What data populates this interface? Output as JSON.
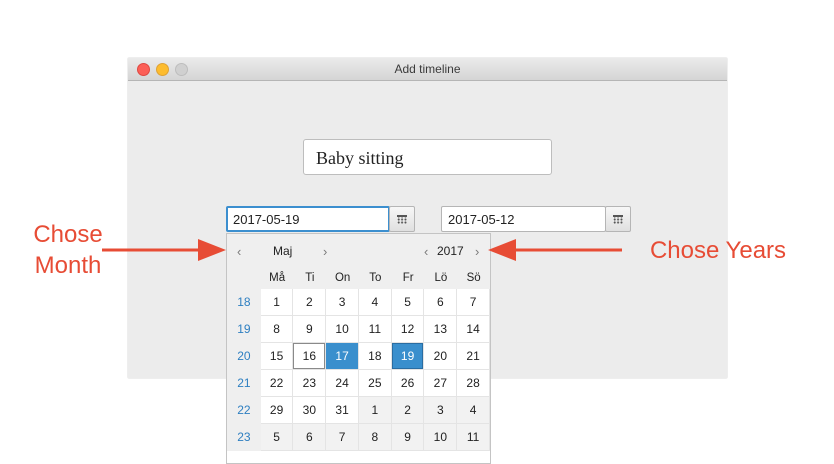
{
  "window": {
    "title": "Add timeline"
  },
  "form": {
    "name_value": "Baby sitting",
    "start_date": "2017-05-19",
    "end_date": "2017-05-12"
  },
  "datepicker": {
    "month": "Maj",
    "year": "2017",
    "prev_arrow": "‹",
    "next_arrow": "›",
    "weekdays": [
      "Må",
      "Ti",
      "On",
      "To",
      "Fr",
      "Lö",
      "Sö"
    ],
    "weeks": [
      {
        "num": "18",
        "days": [
          {
            "d": "1"
          },
          {
            "d": "2"
          },
          {
            "d": "3"
          },
          {
            "d": "4"
          },
          {
            "d": "5"
          },
          {
            "d": "6"
          },
          {
            "d": "7"
          }
        ]
      },
      {
        "num": "19",
        "days": [
          {
            "d": "8"
          },
          {
            "d": "9"
          },
          {
            "d": "10"
          },
          {
            "d": "11"
          },
          {
            "d": "12"
          },
          {
            "d": "13"
          },
          {
            "d": "14"
          }
        ]
      },
      {
        "num": "20",
        "days": [
          {
            "d": "15"
          },
          {
            "d": "16",
            "today": true
          },
          {
            "d": "17",
            "selected": true
          },
          {
            "d": "18"
          },
          {
            "d": "19",
            "selected": true,
            "today": true
          },
          {
            "d": "20"
          },
          {
            "d": "21"
          }
        ]
      },
      {
        "num": "21",
        "days": [
          {
            "d": "22"
          },
          {
            "d": "23"
          },
          {
            "d": "24"
          },
          {
            "d": "25"
          },
          {
            "d": "26"
          },
          {
            "d": "27"
          },
          {
            "d": "28"
          }
        ]
      },
      {
        "num": "22",
        "days": [
          {
            "d": "29"
          },
          {
            "d": "30"
          },
          {
            "d": "31"
          },
          {
            "d": "1",
            "other": true
          },
          {
            "d": "2",
            "other": true
          },
          {
            "d": "3",
            "other": true
          },
          {
            "d": "4",
            "other": true
          }
        ]
      },
      {
        "num": "23",
        "days": [
          {
            "d": "5",
            "other": true
          },
          {
            "d": "6",
            "other": true
          },
          {
            "d": "7",
            "other": true
          },
          {
            "d": "8",
            "other": true
          },
          {
            "d": "9",
            "other": true
          },
          {
            "d": "10",
            "other": true
          },
          {
            "d": "11",
            "other": true
          }
        ]
      }
    ]
  },
  "annotations": {
    "left_line1": "Chose",
    "left_line2": "Month",
    "right": "Chose Years",
    "color": "#e74c35"
  }
}
